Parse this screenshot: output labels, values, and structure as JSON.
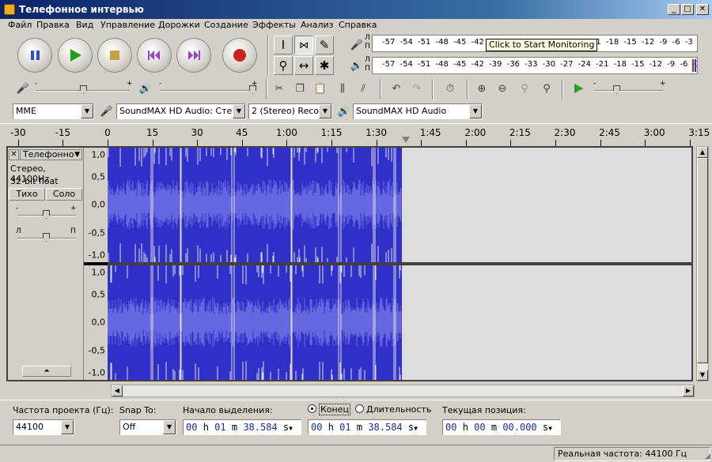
{
  "window": {
    "title": "Телефонное интервью"
  },
  "menu": [
    "Файл",
    "Правка",
    "Вид",
    "Управление",
    "Дорожки",
    "Создание",
    "Эффекты",
    "Анализ",
    "Справка"
  ],
  "meters": {
    "record_ticks": "-57 -54 -51 -48 -45 -42 -3",
    "record_ticks_right": "21 -18 -15 -12 -9 -6 -3 0",
    "play_ticks": "-57 -54 -51 -48 -45 -42 -39 -36 -33 -30 -27 -24 -21 -18 -15 -12 -9 -6 -3 0",
    "lr": [
      "Л",
      "П"
    ],
    "tooltip": "Click to Start Monitoring"
  },
  "devices": {
    "host": "MME",
    "input": "SoundMAX HD Audio: Стерео",
    "channels": "2 (Stereo) Record",
    "output": "SoundMAX HD Audio"
  },
  "ruler": {
    "ticks": [
      "-30",
      "-15",
      "0",
      "15",
      "30",
      "45",
      "1:00",
      "1:15",
      "1:30",
      "1:45",
      "2:00",
      "2:15",
      "2:30",
      "2:45",
      "3:00",
      "3:15"
    ]
  },
  "track": {
    "name": "Телефонно",
    "info1": "Стерео, 44100Hz",
    "info2": "32-bit float",
    "mute": "Тихо",
    "solo": "Соло",
    "gain_minus": "-",
    "gain_plus": "+",
    "pan_left": "Л",
    "pan_right": "П",
    "close": "✕",
    "menu_arrow": "▼",
    "collapse": "⏶",
    "y_labels": [
      "1,0",
      "0,5",
      "0,0",
      "-0,5",
      "-1,0"
    ]
  },
  "bottom": {
    "rate_label": "Частота проекта (Гц):",
    "rate_value": "44100",
    "snap_label": "Snap To:",
    "snap_value": "Off",
    "start_label": "Начало выделения:",
    "end_label": "Конец",
    "length_label": "Длительность",
    "pos_label": "Текущая позиция:",
    "start_time": {
      "h": "00",
      "m": "01",
      "s": "38.584"
    },
    "end_time": {
      "h": "00",
      "m": "01",
      "s": "38.584"
    },
    "pos_time": {
      "h": "00",
      "m": "00",
      "s": "00.000"
    },
    "units": {
      "h": "h",
      "m": "m",
      "s": "s"
    }
  },
  "status": {
    "rate": "Реальная частота: 44100 Гц"
  },
  "colors": {
    "wave": "#3030c8",
    "wave_rms": "#6666e0",
    "background": "#dcdcdc"
  }
}
